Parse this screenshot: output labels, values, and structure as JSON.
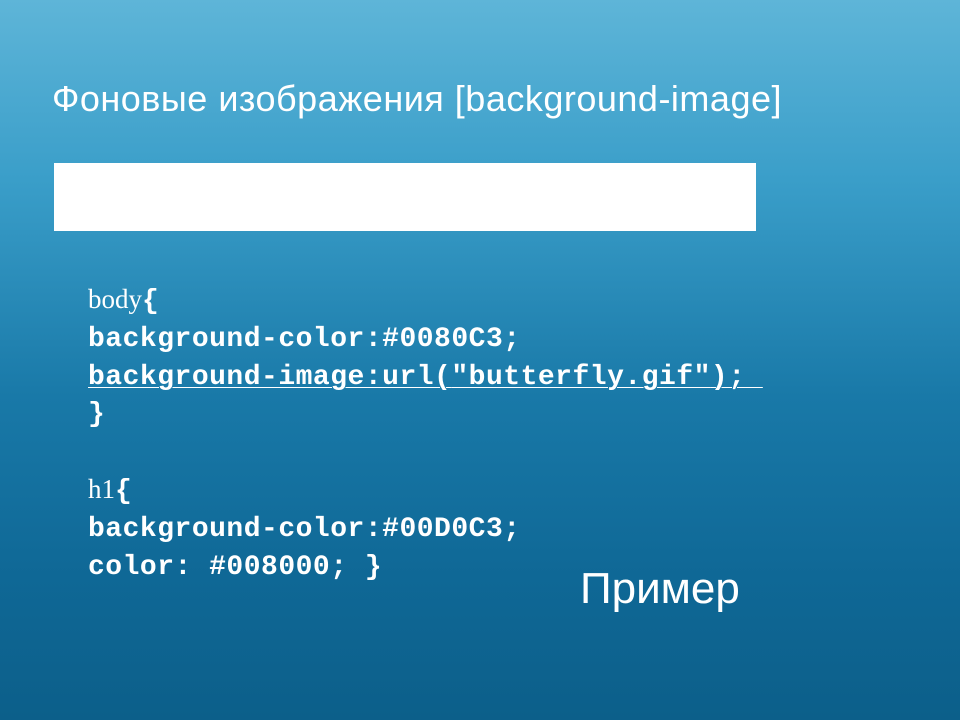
{
  "slide": {
    "title": "Фоновые изображения [background-image]",
    "code": {
      "line1_selector": "body",
      "line1_brace": "{",
      "line2": "background-color:#0080C3;",
      "line3_part1": "background-image:url(",
      "line3_part2": "\"butterfly.gif\"",
      "line3_part3": ");",
      "line4": "}",
      "line5_selector": "h1",
      "line5_brace": "{",
      "line6": "background-color:#00D0C3;",
      "line7": "color: #008000; }"
    },
    "example_label": "Пример"
  }
}
